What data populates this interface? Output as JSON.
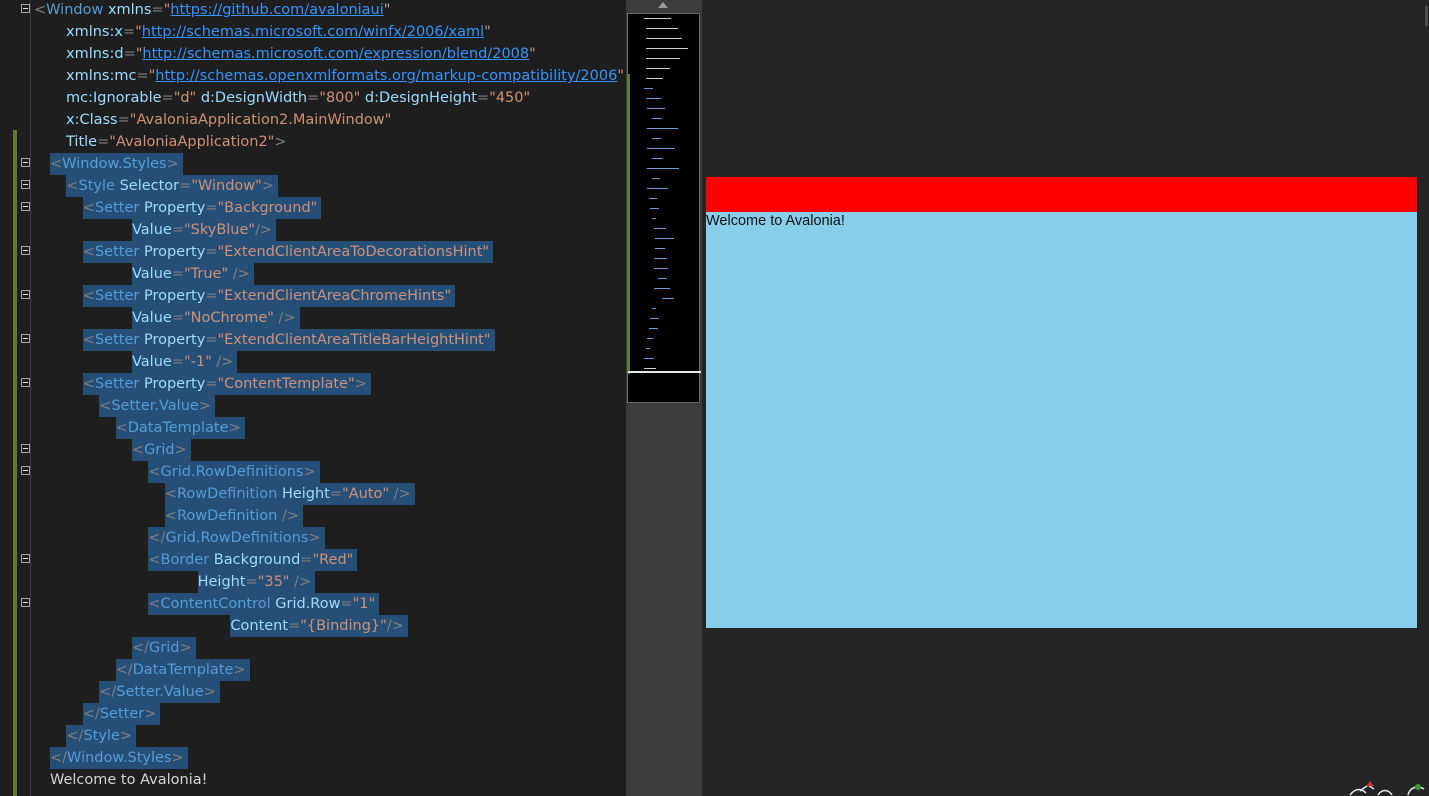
{
  "editor": {
    "lines": [
      {
        "fold": true,
        "indent": 0,
        "sel": false,
        "tokens": [
          [
            "p",
            "<"
          ],
          [
            "t",
            "Window "
          ],
          [
            "a",
            "xmlns"
          ],
          [
            "p",
            "="
          ],
          [
            "v",
            "\""
          ],
          [
            "u",
            "https://github.com/avaloniaui"
          ],
          [
            "v",
            "\""
          ]
        ]
      },
      {
        "fold": false,
        "indent": 1,
        "sel": false,
        "tokens": [
          [
            "a",
            "xmlns:x"
          ],
          [
            "p",
            "="
          ],
          [
            "v",
            "\""
          ],
          [
            "u",
            "http://schemas.microsoft.com/winfx/2006/xaml"
          ],
          [
            "v",
            "\""
          ]
        ]
      },
      {
        "fold": false,
        "indent": 1,
        "sel": false,
        "tokens": [
          [
            "a",
            "xmlns:d"
          ],
          [
            "p",
            "="
          ],
          [
            "v",
            "\""
          ],
          [
            "u",
            "http://schemas.microsoft.com/expression/blend/2008"
          ],
          [
            "v",
            "\""
          ]
        ]
      },
      {
        "fold": false,
        "indent": 1,
        "sel": false,
        "tokens": [
          [
            "a",
            "xmlns:mc"
          ],
          [
            "p",
            "="
          ],
          [
            "v",
            "\""
          ],
          [
            "u",
            "http://schemas.openxmlformats.org/markup-compatibility/2006"
          ],
          [
            "v",
            "\""
          ]
        ]
      },
      {
        "fold": false,
        "indent": 1,
        "sel": false,
        "tokens": [
          [
            "a",
            "mc:Ignorable"
          ],
          [
            "p",
            "="
          ],
          [
            "v",
            "\"d\" "
          ],
          [
            "a",
            "d:DesignWidth"
          ],
          [
            "p",
            "="
          ],
          [
            "v",
            "\"800\" "
          ],
          [
            "a",
            "d:DesignHeight"
          ],
          [
            "p",
            "="
          ],
          [
            "v",
            "\"450\""
          ]
        ]
      },
      {
        "fold": false,
        "indent": 1,
        "sel": false,
        "tokens": [
          [
            "a",
            "x:Class"
          ],
          [
            "p",
            "="
          ],
          [
            "v",
            "\"AvaloniaApplication2.MainWindow\""
          ]
        ]
      },
      {
        "fold": false,
        "indent": 1,
        "sel": false,
        "tokens": [
          [
            "a",
            "Title"
          ],
          [
            "p",
            "="
          ],
          [
            "v",
            "\"AvaloniaApplication2\""
          ],
          [
            "p",
            ">"
          ]
        ]
      },
      {
        "fold": true,
        "indent": 0,
        "sel": true,
        "tokens": [
          [
            "p",
            "<"
          ],
          [
            "t",
            "Window.Styles"
          ],
          [
            "p",
            ">"
          ]
        ]
      },
      {
        "fold": true,
        "indent": 1,
        "sel": true,
        "tokens": [
          [
            "p",
            "<"
          ],
          [
            "t",
            "Style "
          ],
          [
            "a",
            "Selector"
          ],
          [
            "p",
            "="
          ],
          [
            "v",
            "\"Window\""
          ],
          [
            "p",
            ">"
          ]
        ]
      },
      {
        "fold": true,
        "indent": 2,
        "sel": true,
        "tokens": [
          [
            "p",
            "<"
          ],
          [
            "t",
            "Setter "
          ],
          [
            "a",
            "Property"
          ],
          [
            "p",
            "="
          ],
          [
            "v",
            "\"Background\""
          ]
        ]
      },
      {
        "fold": false,
        "indent": 5,
        "sel": true,
        "tokens": [
          [
            "a",
            "Value"
          ],
          [
            "p",
            "="
          ],
          [
            "v",
            "\"SkyBlue\""
          ],
          [
            "p",
            "/>"
          ]
        ]
      },
      {
        "fold": true,
        "indent": 2,
        "sel": true,
        "tokens": [
          [
            "p",
            "<"
          ],
          [
            "t",
            "Setter "
          ],
          [
            "a",
            "Property"
          ],
          [
            "p",
            "="
          ],
          [
            "v",
            "\"ExtendClientAreaToDecorationsHint\""
          ]
        ]
      },
      {
        "fold": false,
        "indent": 5,
        "sel": true,
        "tokens": [
          [
            "a",
            "Value"
          ],
          [
            "p",
            "="
          ],
          [
            "v",
            "\"True\" "
          ],
          [
            "p",
            "/>"
          ]
        ]
      },
      {
        "fold": true,
        "indent": 2,
        "sel": true,
        "tokens": [
          [
            "p",
            "<"
          ],
          [
            "t",
            "Setter "
          ],
          [
            "a",
            "Property"
          ],
          [
            "p",
            "="
          ],
          [
            "v",
            "\"ExtendClientAreaChromeHints\""
          ]
        ]
      },
      {
        "fold": false,
        "indent": 5,
        "sel": true,
        "tokens": [
          [
            "a",
            "Value"
          ],
          [
            "p",
            "="
          ],
          [
            "v",
            "\"NoChrome\" "
          ],
          [
            "p",
            "/>"
          ]
        ]
      },
      {
        "fold": true,
        "indent": 2,
        "sel": true,
        "tokens": [
          [
            "p",
            "<"
          ],
          [
            "t",
            "Setter "
          ],
          [
            "a",
            "Property"
          ],
          [
            "p",
            "="
          ],
          [
            "v",
            "\"ExtendClientAreaTitleBarHeightHint\""
          ]
        ]
      },
      {
        "fold": false,
        "indent": 5,
        "sel": true,
        "tokens": [
          [
            "a",
            "Value"
          ],
          [
            "p",
            "="
          ],
          [
            "v",
            "\"-1\" "
          ],
          [
            "p",
            "/>"
          ]
        ]
      },
      {
        "fold": true,
        "indent": 2,
        "sel": true,
        "tokens": [
          [
            "p",
            "<"
          ],
          [
            "t",
            "Setter "
          ],
          [
            "a",
            "Property"
          ],
          [
            "p",
            "="
          ],
          [
            "v",
            "\"ContentTemplate\""
          ],
          [
            "p",
            ">"
          ]
        ]
      },
      {
        "fold": false,
        "indent": 3,
        "sel": true,
        "tokens": [
          [
            "p",
            "<"
          ],
          [
            "t",
            "Setter.Value"
          ],
          [
            "p",
            ">"
          ]
        ]
      },
      {
        "fold": false,
        "indent": 4,
        "sel": true,
        "tokens": [
          [
            "p",
            "<"
          ],
          [
            "t",
            "DataTemplate"
          ],
          [
            "p",
            ">"
          ]
        ]
      },
      {
        "fold": true,
        "indent": 5,
        "sel": true,
        "tokens": [
          [
            "p",
            "<"
          ],
          [
            "t",
            "Grid"
          ],
          [
            "p",
            ">"
          ]
        ]
      },
      {
        "fold": true,
        "indent": 6,
        "sel": true,
        "tokens": [
          [
            "p",
            "<"
          ],
          [
            "t",
            "Grid.RowDefinitions"
          ],
          [
            "p",
            ">"
          ]
        ]
      },
      {
        "fold": false,
        "indent": 7,
        "sel": true,
        "tokens": [
          [
            "p",
            "<"
          ],
          [
            "t",
            "RowDefinition "
          ],
          [
            "a",
            "Height"
          ],
          [
            "p",
            "="
          ],
          [
            "v",
            "\"Auto\" "
          ],
          [
            "p",
            "/>"
          ]
        ]
      },
      {
        "fold": false,
        "indent": 7,
        "sel": true,
        "tokens": [
          [
            "p",
            "<"
          ],
          [
            "t",
            "RowDefinition "
          ],
          [
            "p",
            "/>"
          ]
        ]
      },
      {
        "fold": false,
        "indent": 6,
        "sel": true,
        "tokens": [
          [
            "p",
            "</"
          ],
          [
            "t",
            "Grid.RowDefinitions"
          ],
          [
            "p",
            ">"
          ]
        ]
      },
      {
        "fold": true,
        "indent": 6,
        "sel": true,
        "tokens": [
          [
            "p",
            "<"
          ],
          [
            "t",
            "Border "
          ],
          [
            "a",
            "Background"
          ],
          [
            "p",
            "="
          ],
          [
            "v",
            "\"Red\""
          ]
        ]
      },
      {
        "fold": false,
        "indent": 9,
        "sel": true,
        "tokens": [
          [
            "a",
            "Height"
          ],
          [
            "p",
            "="
          ],
          [
            "v",
            "\"35\" "
          ],
          [
            "p",
            "/>"
          ]
        ]
      },
      {
        "fold": true,
        "indent": 6,
        "sel": true,
        "tokens": [
          [
            "p",
            "<"
          ],
          [
            "t",
            "ContentControl "
          ],
          [
            "a",
            "Grid.Row"
          ],
          [
            "p",
            "="
          ],
          [
            "v",
            "\"1\""
          ]
        ]
      },
      {
        "fold": false,
        "indent": 11,
        "sel": true,
        "tokens": [
          [
            "a",
            "Content"
          ],
          [
            "p",
            "="
          ],
          [
            "v",
            "\"{Binding}\""
          ],
          [
            "p",
            "/>"
          ]
        ]
      },
      {
        "fold": false,
        "indent": 5,
        "sel": true,
        "tokens": [
          [
            "p",
            "</"
          ],
          [
            "t",
            "Grid"
          ],
          [
            "p",
            ">"
          ]
        ]
      },
      {
        "fold": false,
        "indent": 4,
        "sel": true,
        "tokens": [
          [
            "p",
            "</"
          ],
          [
            "t",
            "DataTemplate"
          ],
          [
            "p",
            ">"
          ]
        ]
      },
      {
        "fold": false,
        "indent": 3,
        "sel": true,
        "tokens": [
          [
            "p",
            "</"
          ],
          [
            "t",
            "Setter.Value"
          ],
          [
            "p",
            ">"
          ]
        ]
      },
      {
        "fold": false,
        "indent": 2,
        "sel": true,
        "tokens": [
          [
            "p",
            "</"
          ],
          [
            "t",
            "Setter"
          ],
          [
            "p",
            ">"
          ]
        ]
      },
      {
        "fold": false,
        "indent": 1,
        "sel": true,
        "tokens": [
          [
            "p",
            "</"
          ],
          [
            "t",
            "Style"
          ],
          [
            "p",
            ">"
          ]
        ]
      },
      {
        "fold": false,
        "indent": 0,
        "sel": true,
        "tokens": [
          [
            "p",
            "</"
          ],
          [
            "t",
            "Window.Styles"
          ],
          [
            "p",
            ">"
          ]
        ]
      },
      {
        "fold": false,
        "indent": 0,
        "sel": false,
        "tokens": [
          [
            "x",
            "Welcome to Avalonia!"
          ]
        ]
      }
    ]
  },
  "preview": {
    "welcome_text": "Welcome to Avalonia!",
    "title_band_color": "#FF0000",
    "background_color": "#87CEEB"
  },
  "theme": {
    "selection": "#264F78",
    "punctuation": "#808080",
    "tag": "#569CD6",
    "attribute": "#9CDCFE",
    "value": "#CE9178",
    "link": "#3794FF"
  }
}
